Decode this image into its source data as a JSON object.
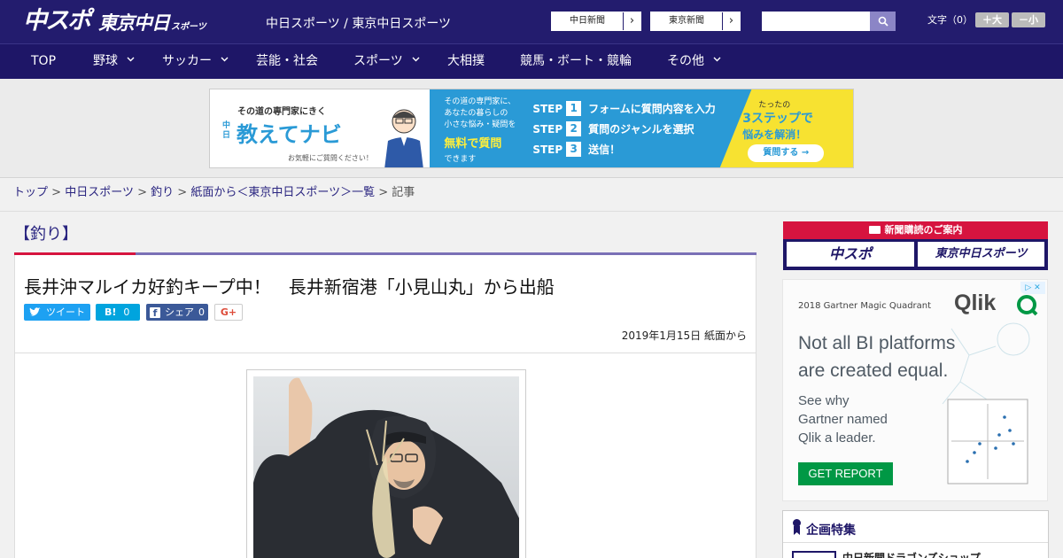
{
  "header": {
    "logo_main": "中スポ",
    "logo_sub": "東京中日",
    "logo_sup": "スポーツ",
    "site_label": "中日スポーツ / 東京中日スポーツ",
    "paper_buttons": [
      "中日新聞",
      "東京新聞"
    ],
    "search_placeholder": "",
    "font_size_label": "文字（0）",
    "font_bigger": "＋大",
    "font_smaller": "－小"
  },
  "nav": [
    {
      "label": "TOP",
      "has_dropdown": false
    },
    {
      "label": "野球",
      "has_dropdown": true
    },
    {
      "label": "サッカー",
      "has_dropdown": true
    },
    {
      "label": "芸能・社会",
      "has_dropdown": false
    },
    {
      "label": "スポーツ",
      "has_dropdown": true
    },
    {
      "label": "大相撲",
      "has_dropdown": false
    },
    {
      "label": "競馬・ボート・競輪",
      "has_dropdown": false
    },
    {
      "label": "その他",
      "has_dropdown": true
    }
  ],
  "banner": {
    "tagline": "その道の専門家にきく",
    "brand_small": "中日",
    "brand": "教えてナビ",
    "note": "お気軽にご質問ください！",
    "lead": [
      "その道の専門家に、",
      "あなたの暮らしの",
      "小さな悩み・疑問を"
    ],
    "free": "無料で質問",
    "can": "できます",
    "steps": [
      {
        "label": "STEP",
        "num": "1",
        "text": "フォームに質問内容を入力"
      },
      {
        "label": "STEP",
        "num": "2",
        "text": "質問のジャンルを選択"
      },
      {
        "label": "STEP",
        "num": "3",
        "text": "送信！"
      }
    ],
    "cta_top": "たったの",
    "cta_main": "3ステップで",
    "cta_sub": "悩みを解消！",
    "cta_button": "質問する →"
  },
  "breadcrumb": {
    "items": [
      "トップ",
      "中日スポーツ",
      "釣り",
      "紙面から＜東京中日スポーツ＞一覧"
    ],
    "current": "記事",
    "separator": ">"
  },
  "category": "【釣り】",
  "article": {
    "title": "長井沖マルイカ好釣キープ中！　長井新宿港「小見山丸」から出船",
    "share": {
      "tweet": "ツイート",
      "hatena": "B!",
      "hatena_count": "0",
      "facebook": "シェア",
      "facebook_count": "0",
      "gplus": "G+"
    },
    "date": "2019年1月15日 紙面から"
  },
  "sidebar": {
    "subscribe_title": "新聞購読のご案内",
    "logos": [
      "中スポ",
      "東京中日スポーツ"
    ],
    "ad": {
      "kicker": "2018 Gartner Magic Quadrant",
      "brand": "Qlik",
      "headline": [
        "Not all BI platforms",
        "are created equal."
      ],
      "body": [
        "See why",
        "Gartner named",
        "Qlik a leader."
      ],
      "cta": "GET REPORT"
    },
    "special_title": "企画特集",
    "special_first_item": "中日新聞ドラゴンズショップ"
  },
  "colors": {
    "header_bg": "#231c6e",
    "nav_bg": "#1e1667",
    "accent_red": "#d6143f",
    "accent_purple": "#7a70b6",
    "link": "#2a2580",
    "twitter": "#1da1f2",
    "hatena": "#00a4de",
    "facebook": "#3b5998",
    "ad_green": "#009845"
  }
}
